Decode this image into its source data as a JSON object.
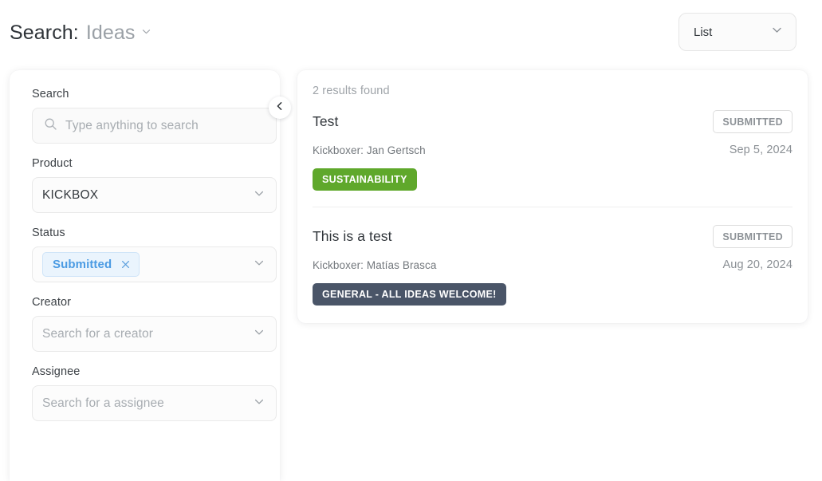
{
  "header": {
    "title_main": "Search:",
    "title_sub": "Ideas",
    "title_chevron_icon": "chevron-down-icon"
  },
  "view_select": {
    "value": "List",
    "chevron_icon": "chevron-down-icon"
  },
  "collapse_handle": {
    "icon": "chevron-left-icon"
  },
  "sidebar": {
    "fields": [
      {
        "label": "Search",
        "type": "search",
        "icon": "search-icon",
        "placeholder": "Type anything to search",
        "value": ""
      },
      {
        "label": "Product",
        "type": "select",
        "value": "KICKBOX",
        "chevron_icon": "chevron-down-icon"
      },
      {
        "label": "Status",
        "type": "multiselect",
        "chip": {
          "label": "Submitted",
          "remove_icon": "close-icon"
        },
        "chevron_icon": "chevron-down-icon"
      },
      {
        "label": "Creator",
        "type": "select",
        "placeholder": "Search for a creator",
        "chevron_icon": "chevron-down-icon"
      },
      {
        "label": "Assignee",
        "type": "select",
        "placeholder": "Search for a assignee",
        "chevron_icon": "chevron-down-icon"
      }
    ]
  },
  "results": {
    "count_label": "2 results found",
    "items": [
      {
        "title": "Test",
        "status": "SUBMITTED",
        "kickboxer": "Kickboxer: Jan Gertsch",
        "date": "Sep 5, 2024",
        "tag": "SUSTAINABILITY",
        "tag_color": "#5FA82B"
      },
      {
        "title": "This is a test",
        "status": "SUBMITTED",
        "kickboxer": "Kickboxer: Matías Brasca",
        "date": "Aug 20, 2024",
        "tag": "GENERAL - ALL IDEAS WELCOME!",
        "tag_color": "#4a5568"
      }
    ]
  },
  "colors": {
    "accent_blue": "#4b9be3",
    "green_tag": "#5FA82B",
    "slate_tag": "#4a5568",
    "page_bg": "#ffffff"
  }
}
